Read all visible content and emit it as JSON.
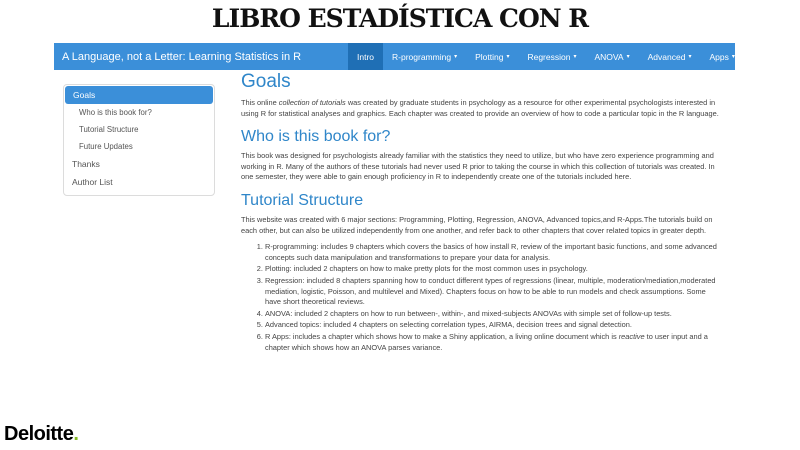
{
  "slide": {
    "title": "LIBRO ESTADÍSTICA CON R",
    "logo_text": "Deloitte",
    "logo_dot": ".",
    "logo_dot_color": "#86bc25"
  },
  "navbar": {
    "brand": "A Language, not a Letter: Learning Statistics in R",
    "color": "#3b8fd9",
    "items": [
      {
        "label": "Intro",
        "active": true
      },
      {
        "label": "R-programming",
        "dropdown": true
      },
      {
        "label": "Plotting",
        "dropdown": true
      },
      {
        "label": "Regression",
        "dropdown": true
      },
      {
        "label": "ANOVA",
        "dropdown": true
      },
      {
        "label": "Advanced",
        "dropdown": true
      },
      {
        "label": "Apps",
        "dropdown": true
      }
    ],
    "caret": "▾"
  },
  "toc": {
    "items": [
      {
        "label": "Goals",
        "active": true
      },
      {
        "label": "Who is this book for?",
        "sub": true
      },
      {
        "label": "Tutorial Structure",
        "sub": true
      },
      {
        "label": "Future Updates",
        "sub": true
      },
      {
        "label": "Thanks"
      },
      {
        "label": "Author List"
      }
    ]
  },
  "content": {
    "goals_heading": "Goals",
    "goals_text_1": "This online ",
    "goals_text_em": "collection of tutorials",
    "goals_text_2": " was created by graduate students in psychology as a resource for other experimental psychologists interested in using R for statistical analyses and graphics. Each chapter was created to provide an overview of how to code a particular topic in the R language.",
    "who_heading": "Who is this book for?",
    "who_text": "This book was designed for psychologists already familiar with the statistics they need to utilize, but who have zero experience programming and working in R. Many of the authors of these tutorials had never used R prior to taking the course in which this collection of tutorials was created. In one semester, they were able to gain enough proficiency in R to independently create one of the tutorials included here.",
    "structure_heading": "Tutorial Structure",
    "structure_text": "This website was created with 6 major sections: Programming, Plotting, Regression, ANOVA, Advanced topics,and R-Apps.The tutorials build on each other, but can also be utilized independently from one another, and refer back to other chapters that cover related topics in greater depth.",
    "list": [
      "R-programming: includes 9 chapters which covers the basics of how install R, review of the important basic functions, and some advanced concepts such data manipulation and transformations to prepare your data for analysis.",
      "Plotting: included 2 chapters on how to make pretty plots for the most common uses in psychology.",
      "Regression: included 8 chapters spanning how to conduct different types of regressions (linear, multiple, moderation/mediation,moderated mediation, logistic, Poisson, and multilevel and Mixed). Chapters focus on how to be able to run models and check assumptions. Some have short theoretical reviews.",
      "ANOVA: included 2 chapters on how to run between-, within-, and mixed-subjects ANOVAs with simple set of follow-up tests.",
      "Advanced topics: included 4 chapters on selecting correlation types, AIRMA, decision trees and signal detection."
    ],
    "list_last_1": "R Apps: includes a chapter which shows how to make a Shiny application, a living online document which is ",
    "list_last_em": "reactive",
    "list_last_2": " to user input and a chapter which shows how an ANOVA parses variance."
  }
}
